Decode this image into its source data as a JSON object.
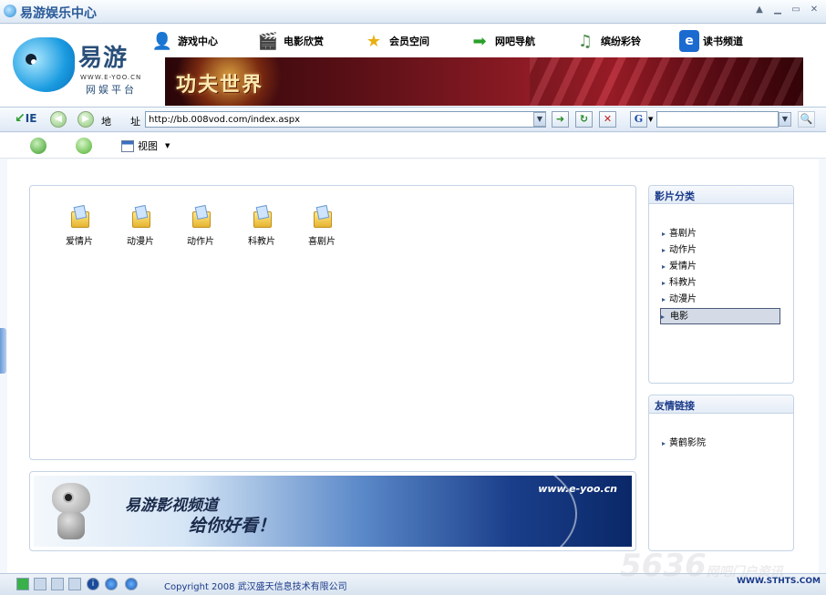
{
  "window": {
    "title": "易游娱乐中心"
  },
  "logo": {
    "brand": "易游",
    "domain": "WWW.E-YOO.CN",
    "platform": "网娱平台"
  },
  "nav": [
    {
      "label": "游戏中心",
      "icon": "game-user-icon"
    },
    {
      "label": "电影欣赏",
      "icon": "film-clapper-icon"
    },
    {
      "label": "会员空间",
      "icon": "star-icon"
    },
    {
      "label": "网吧导航",
      "icon": "green-arrow-icon"
    },
    {
      "label": "缤纷彩铃",
      "icon": "music-note-icon"
    },
    {
      "label": "读书频道",
      "icon": "ie-logo-icon"
    }
  ],
  "banner": {
    "text": "功夫世界"
  },
  "addressbar": {
    "ie_label": "IE",
    "address_label_1": "地",
    "address_label_2": "址",
    "url": "http://bb.008vod.com/index.aspx",
    "search_engine": "G",
    "search_value": ""
  },
  "toolbar2": {
    "view_label": "视图"
  },
  "folders": [
    "爱情片",
    "动漫片",
    "动作片",
    "科教片",
    "喜剧片"
  ],
  "sidebar": {
    "categories_title": "影片分类",
    "categories": [
      "喜剧片",
      "动作片",
      "爱情片",
      "科教片",
      "动漫片",
      "电影"
    ],
    "active_category": "电影",
    "links_title": "友情链接",
    "links": [
      "黄鹤影院"
    ]
  },
  "ad": {
    "slogan_line1": "易游影视频道",
    "slogan_line2": "给你好看！",
    "url": "www.e-yoo.cn"
  },
  "statusbar": {
    "copyright": "Copyright 2008 武汉盛天信息技术有限公司",
    "watermark": "WWW.STHTS.COM"
  },
  "overlay_watermark": {
    "number": "5636",
    "text": "网吧门户资讯"
  }
}
